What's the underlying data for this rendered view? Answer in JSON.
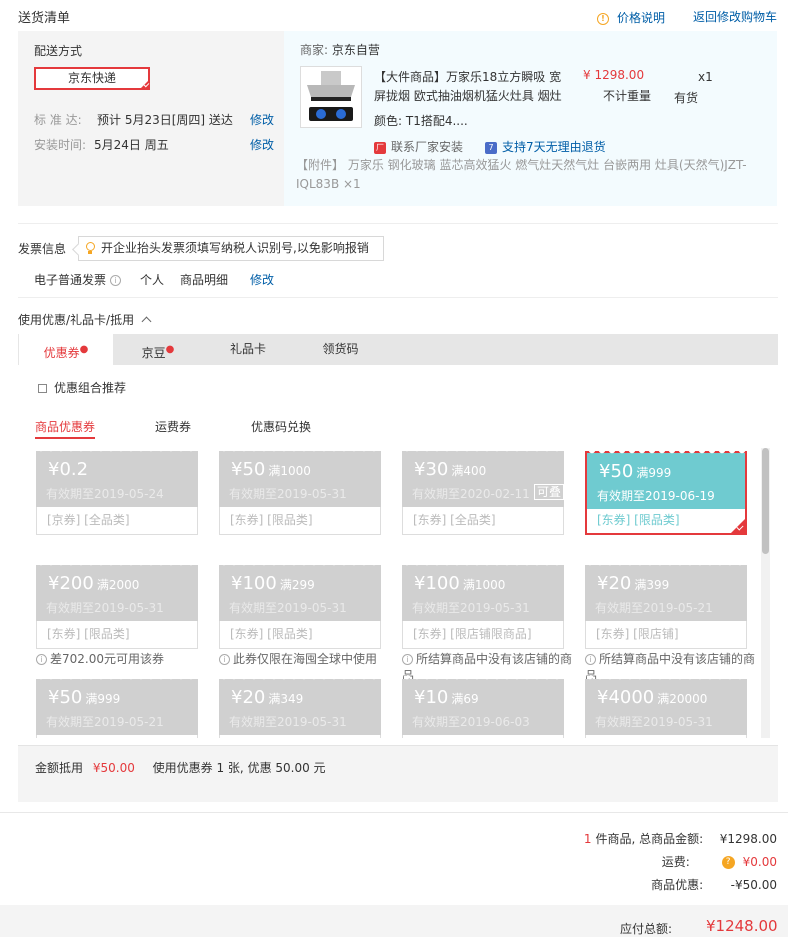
{
  "header": {
    "title": "送货清单",
    "price_info": "价格说明",
    "back_to_cart": "返回修改购物车"
  },
  "shipping": {
    "label": "配送方式",
    "method": "京东快递",
    "standard_label": "标 准 达:",
    "standard_value": "预计 5月23日[周四] 送达",
    "standard_edit": "修改",
    "install_label": "安装时间:",
    "install_value": "5月24日 周五",
    "install_edit": "修改"
  },
  "merchant": {
    "label": "商家:",
    "name": "京东自营",
    "product_title_line1": "【大件商品】万家乐18立方瞬吸 宽",
    "product_title_line2": "屏拢烟 欧式抽油烟机猛火灶具 烟灶",
    "price": "¥ 1298.00",
    "weight": "不计重量",
    "qty": "x1",
    "stock": "有货",
    "color": "颜色: T1搭配4....",
    "service1": "联系厂家安装",
    "service2": "支持7天无理由退货",
    "attachment_line1": "【附件】 万家乐 钢化玻璃 蓝芯高效猛火 燃气灶天然气灶 台嵌两用 灶具(天然气)JZT-",
    "attachment_line2": "IQL83B ×1"
  },
  "invoice": {
    "label": "发票信息",
    "tip": "开企业抬头发票须填写纳税人识别号,以免影响报销",
    "type": "电子普通发票",
    "title": "个人",
    "content": "商品明细",
    "edit": "修改"
  },
  "discount": {
    "section_label": "使用优惠/礼品卡/抵用",
    "tabs": [
      "优惠券",
      "京豆",
      "礼品卡",
      "领货码"
    ],
    "combo_label": "优惠组合推荐",
    "sub_tabs": [
      "商品优惠券",
      "运费券",
      "优惠码兑换"
    ],
    "stack_tag": "可叠",
    "coupons": [
      {
        "amount": "¥0.2",
        "cond": "",
        "expire": "有效期至2019-05-24",
        "tags": "[京券] [全品类]",
        "note": ""
      },
      {
        "amount": "¥50",
        "cond": "满1000",
        "expire": "有效期至2019-05-31",
        "tags": "[东券] [限品类]",
        "note": ""
      },
      {
        "amount": "¥30",
        "cond": "满400",
        "expire": "有效期至2020-02-11",
        "tags": "[东券] [全品类]",
        "note": ""
      },
      {
        "amount": "¥50",
        "cond": "满999",
        "expire": "有效期至2019-06-19",
        "tags": "[东券] [限品类]",
        "note": ""
      },
      {
        "amount": "¥200",
        "cond": "满2000",
        "expire": "有效期至2019-05-31",
        "tags": "[东券] [限品类]",
        "note": "差702.00元可用该券"
      },
      {
        "amount": "¥100",
        "cond": "满299",
        "expire": "有效期至2019-05-31",
        "tags": "[东券] [限品类]",
        "note": "此券仅限在海囤全球中使用"
      },
      {
        "amount": "¥100",
        "cond": "满1000",
        "expire": "有效期至2019-05-31",
        "tags": "[东券] [限店铺限商品]",
        "note": "所结算商品中没有该店铺的商品"
      },
      {
        "amount": "¥20",
        "cond": "满399",
        "expire": "有效期至2019-05-21",
        "tags": "[东券] [限店铺]",
        "note": "所结算商品中没有该店铺的商品"
      },
      {
        "amount": "¥50",
        "cond": "满999",
        "expire": "有效期至2019-05-21",
        "tags": "",
        "note": ""
      },
      {
        "amount": "¥20",
        "cond": "满349",
        "expire": "有效期至2019-05-31",
        "tags": "",
        "note": ""
      },
      {
        "amount": "¥10",
        "cond": "满69",
        "expire": "有效期至2019-06-03",
        "tags": "",
        "note": ""
      },
      {
        "amount": "¥4000",
        "cond": "满20000",
        "expire": "有效期至2019-05-31",
        "tags": "",
        "note": ""
      }
    ],
    "footer_label": "金额抵用",
    "footer_amount": "¥50.00",
    "footer_desc": "使用优惠券 1 张, 优惠 50.00 元"
  },
  "summary": {
    "count": "1",
    "count_suffix": "件商品, 总商品金额:",
    "total_goods": "¥1298.00",
    "shipping_label": "运费:",
    "shipping_value": "¥0.00",
    "discount_label": "商品优惠:",
    "discount_value": "-¥50.00",
    "payable_label": "应付总额:",
    "payable_value": "¥1248.00"
  },
  "colors": {
    "accent_red": "#e4393c",
    "link_blue": "#005ea7",
    "selected_coupon": "#6fcbd0",
    "disabled_coupon": "#d0d0d0"
  }
}
